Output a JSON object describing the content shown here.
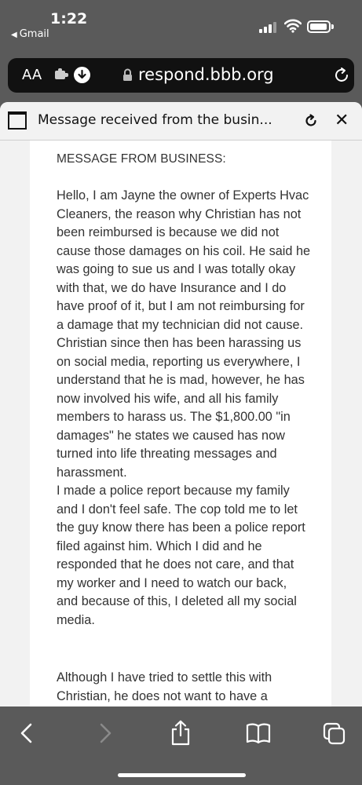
{
  "status_bar": {
    "time": "1:22",
    "back_app": "Gmail"
  },
  "browser": {
    "text_size_label": "AA",
    "url": "respond.bbb.org"
  },
  "tab": {
    "title": "Message received from the busin..."
  },
  "message": {
    "heading": "MESSAGE FROM BUSINESS:",
    "paragraph_1": "Hello, I am Jayne the owner of Experts Hvac\nCleaners, the reason why Christian has not\nbeen reimbursed is because we did not\ncause those damages on his coil. He said he\nwas going to sue us and I was totally okay\nwith that, we do have Insurance and I do\nhave proof of it, but I am not reimbursing for\na damage that my technician did not cause.\nChristian since then has been harassing us\non social media, reporting us everywhere, I\nunderstand that he is mad, however, he has\nnow involved his wife, and all his family\nmembers to harass us. The $1,800.00 \"in\ndamages\" he states we caused has now\nturned into life threating messages and\nharassment.\nI made a police report because my family\nand I don't feel safe. The cop told me to let\nthe guy know there has been a police report\nfiled against him. Which I did and he\nresponded that he does not care, and that\nmy worker and I need to watch our back,\nand because of this, I deleted all my social\nmedia.",
    "paragraph_2": "Although I have tried to settle this with\nChristian, he does not want to have a"
  },
  "icons": {
    "ext": "extension-icon",
    "download": "download-icon",
    "lock": "lock-icon",
    "reload": "reload-icon"
  }
}
